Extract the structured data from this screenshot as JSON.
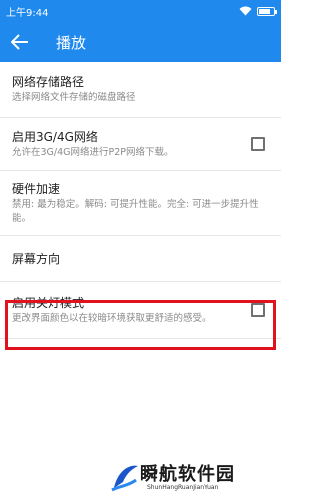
{
  "status_bar": {
    "time": "上午9:44",
    "wifi_icon": "wifi-icon",
    "battery_icon": "battery-icon"
  },
  "app_bar": {
    "back_icon": "arrow-left-icon",
    "title": "播放"
  },
  "settings": [
    {
      "label": "网络存储路径",
      "sub": "选择网络文件存储的磁盘路径",
      "checkbox": false
    },
    {
      "label": "启用3G/4G网络",
      "sub": "允许在3G/4G网络进行P2P网络下载。",
      "checkbox": true,
      "checked": false
    },
    {
      "label": "硬件加速",
      "sub": "禁用: 最为稳定。解码: 可提升性能。完全: 可进一步提升性能。",
      "checkbox": false
    },
    {
      "label": "屏幕方向",
      "sub": "",
      "checkbox": false
    },
    {
      "label": "启用关灯模式",
      "sub": "更改界面颜色以在较暗环境获取更舒适的感受。",
      "checkbox": true,
      "checked": false
    }
  ],
  "highlight_color": "#e0121e",
  "accent_color": "#1f89ee",
  "watermark": {
    "text": "瞬航软件园",
    "sub": "ShunHangRuanJianYuan"
  }
}
